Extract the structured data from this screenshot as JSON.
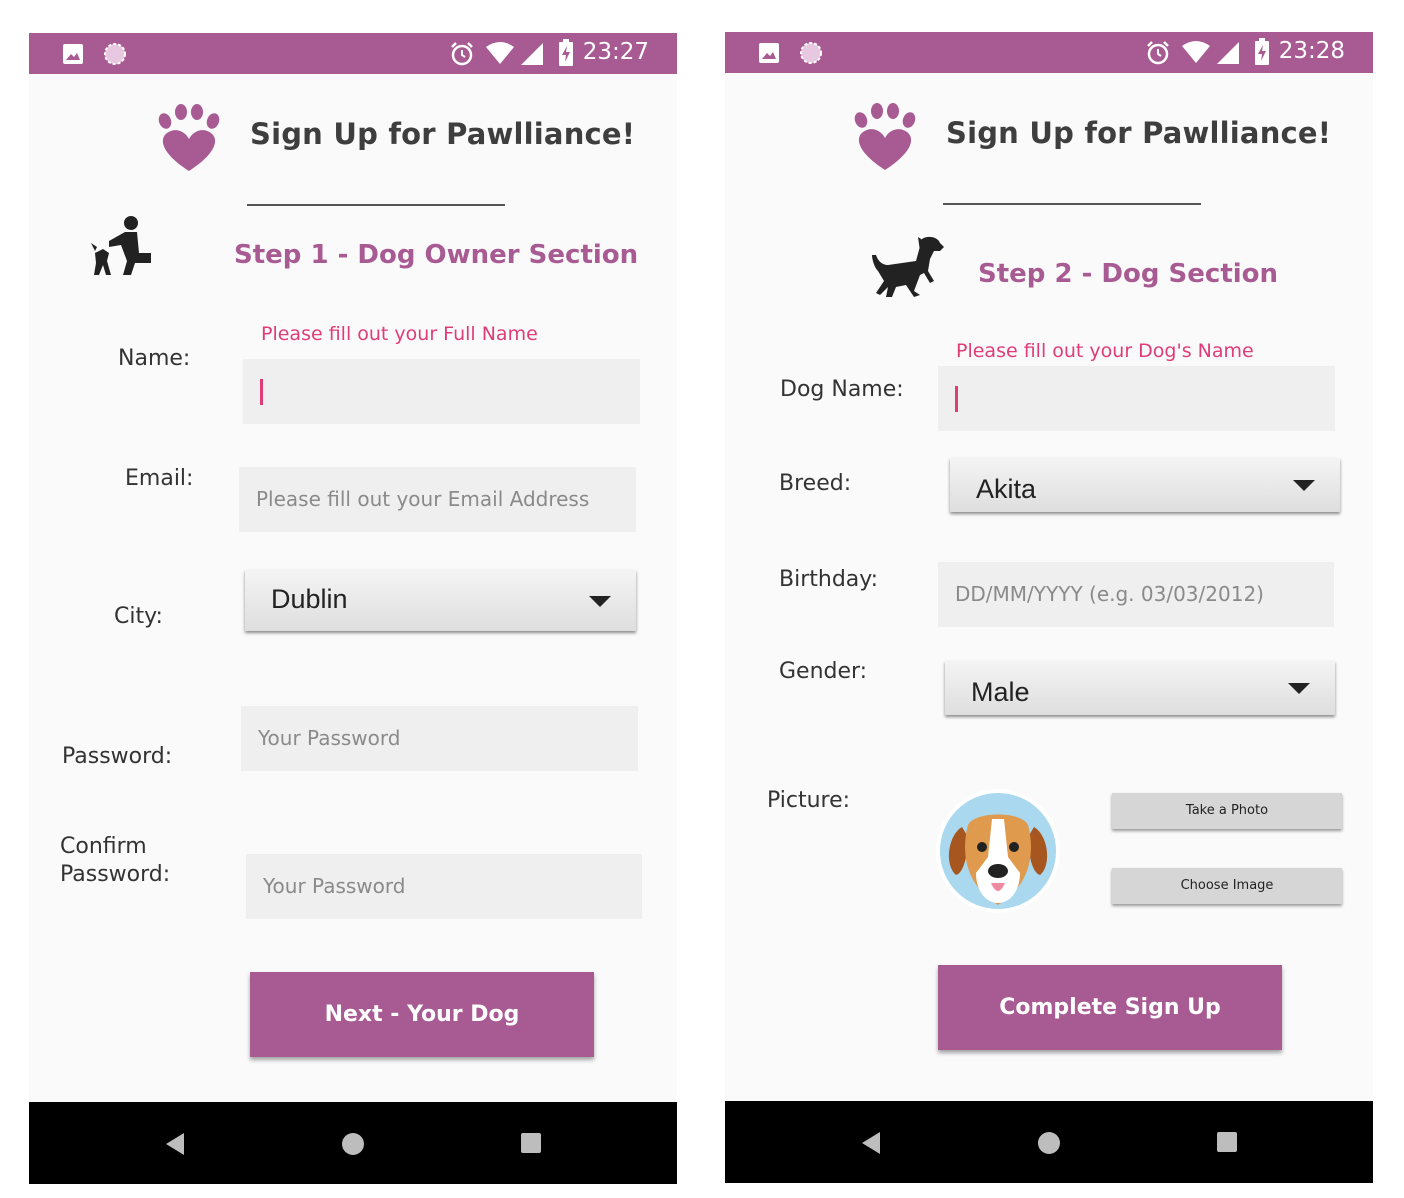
{
  "colors": {
    "brand": "#a85a93",
    "hint": "#e03d78",
    "navbar": "#000000"
  },
  "screen1": {
    "status_time": "23:27",
    "title": "Sign Up for Pawlliance!",
    "step": "Step 1 - Dog Owner Section",
    "name": {
      "label": "Name:",
      "hint": "Please fill out your Full Name",
      "value": ""
    },
    "email": {
      "label": "Email:",
      "placeholder": "Please fill out your Email Address"
    },
    "city": {
      "label": "City:",
      "value": "Dublin"
    },
    "password": {
      "label": "Password:",
      "placeholder": "Your Password"
    },
    "confirm": {
      "label_line1": "Confirm",
      "label_line2": "Password:",
      "placeholder": "Your Password"
    },
    "next_button": "Next - Your Dog"
  },
  "screen2": {
    "status_time": "23:28",
    "title": "Sign Up for Pawlliance!",
    "step": "Step 2 - Dog Section",
    "dog_name": {
      "label": "Dog Name:",
      "hint": "Please fill out your Dog's Name",
      "value": ""
    },
    "breed": {
      "label": "Breed:",
      "value": "Akita"
    },
    "birthday": {
      "label": "Birthday:",
      "placeholder": "DD/MM/YYYY (e.g. 03/03/2012)"
    },
    "gender": {
      "label": "Gender:",
      "value": "Male"
    },
    "picture": {
      "label": "Picture:"
    },
    "take_photo_button": "Take a Photo",
    "choose_image_button": "Choose Image",
    "complete_button": "Complete Sign Up"
  }
}
